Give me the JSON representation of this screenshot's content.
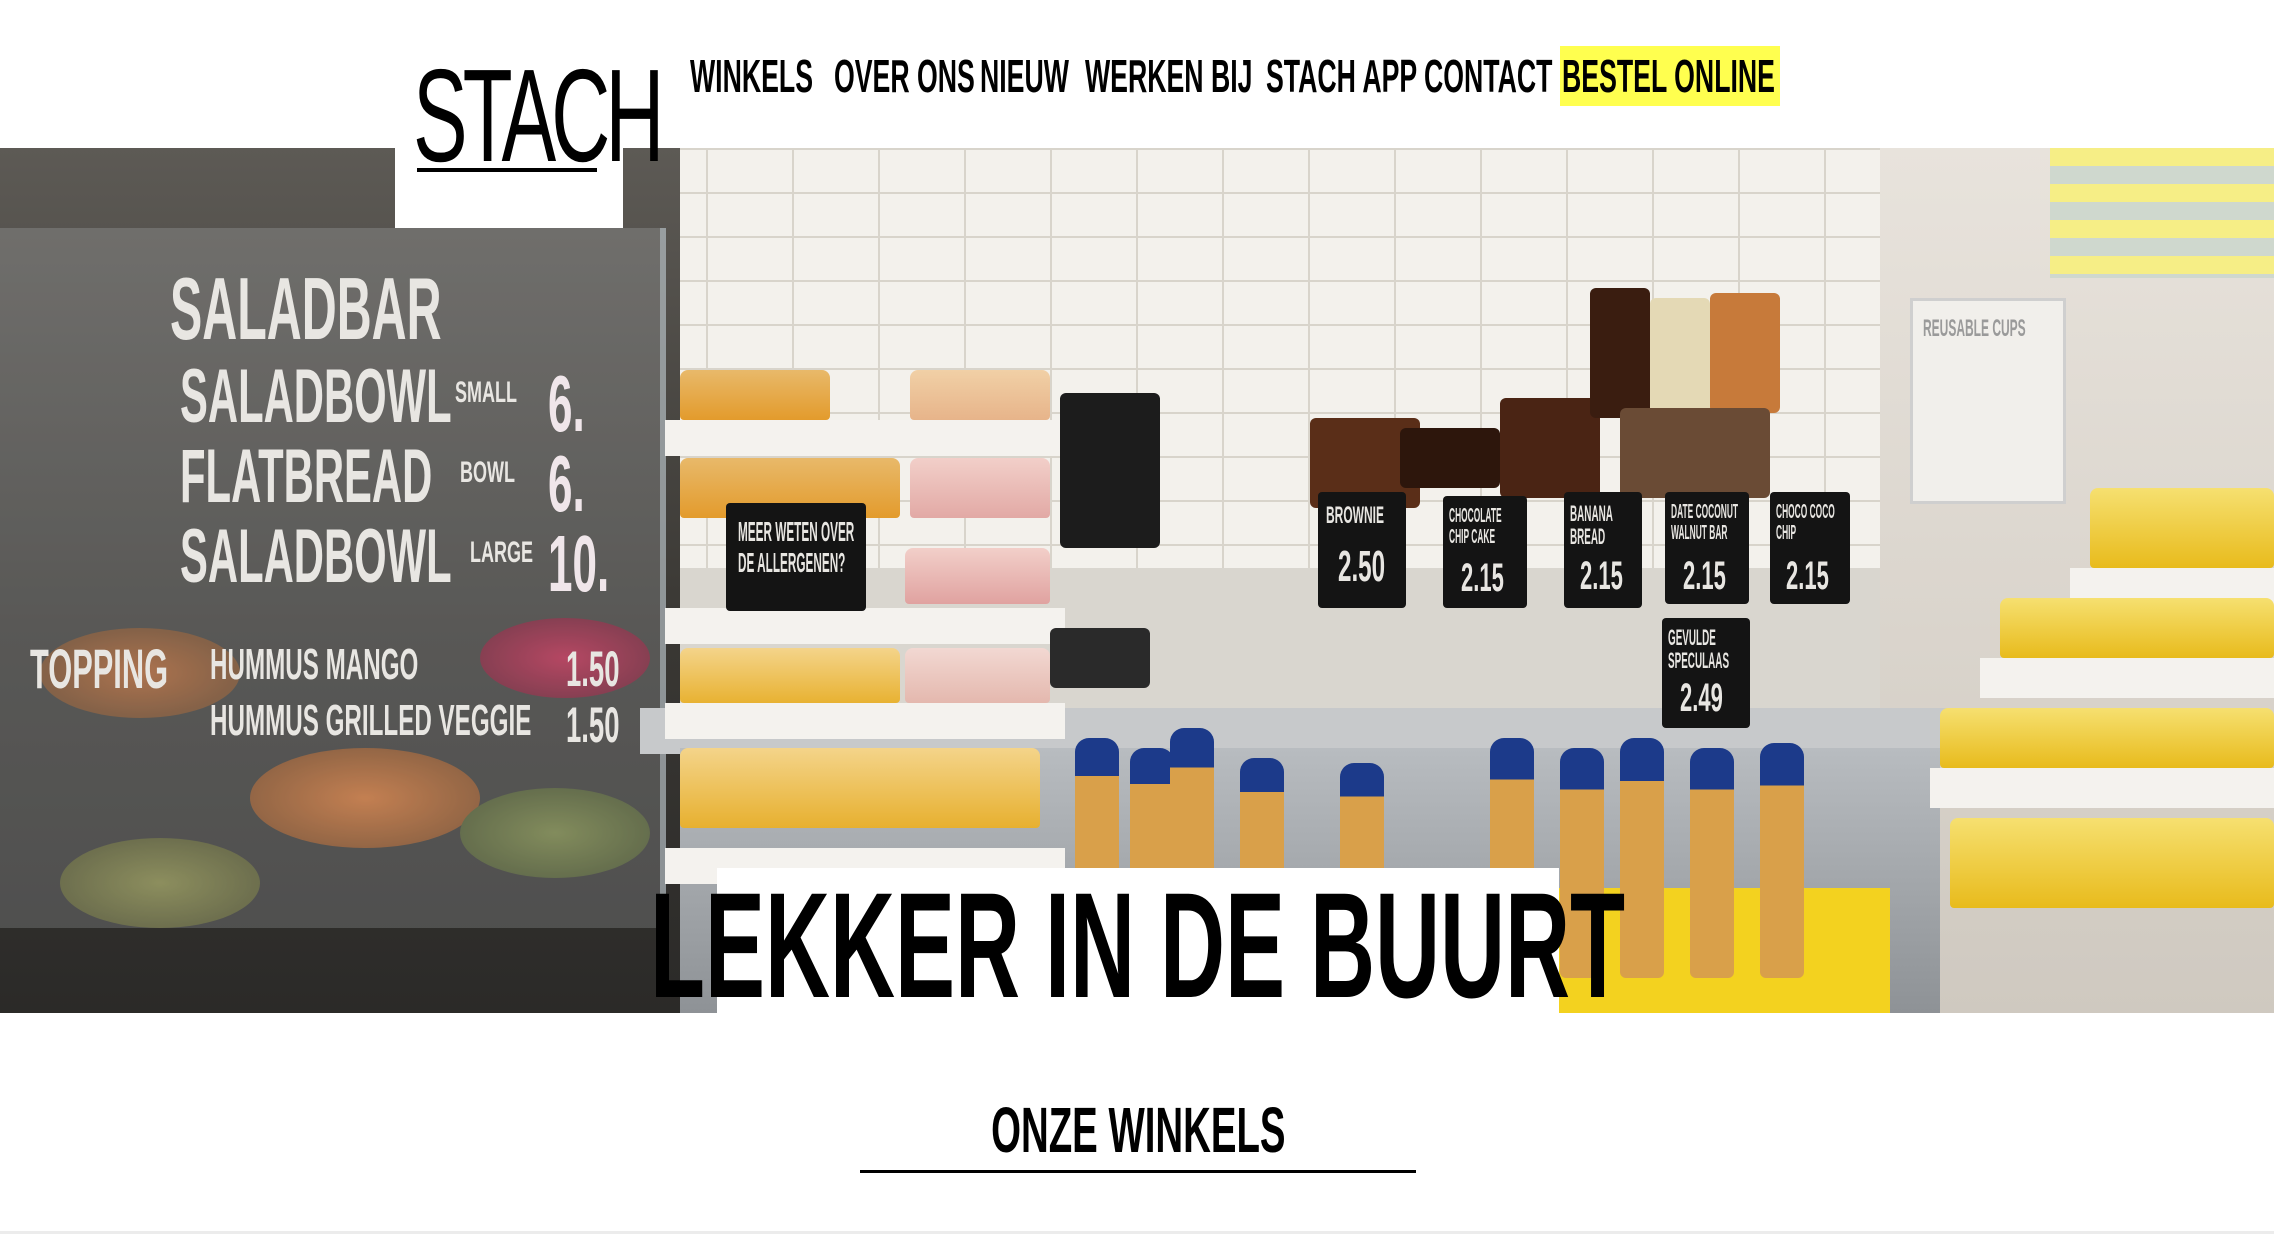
{
  "brand": {
    "logo_text": "STACH"
  },
  "nav": {
    "items": [
      {
        "label": "WINKELS"
      },
      {
        "label": "OVER ONS"
      },
      {
        "label": "NIEUW"
      },
      {
        "label": "WERKEN BIJ"
      },
      {
        "label": "STACH APP"
      },
      {
        "label": "CONTACT"
      },
      {
        "label": "BESTEL ONLINE"
      }
    ],
    "highlight_color": "#ffff4f"
  },
  "hero": {
    "caption": "LEKKER IN DE BUURT",
    "menu_board": {
      "title": "SALADBAR",
      "lines": [
        "SALADBOWL",
        "FLATBREAD",
        "SALADBOWL"
      ],
      "sizes": [
        "SMALL",
        "BOWL",
        "LARGE"
      ],
      "prices": [
        "6.",
        "6.",
        "10."
      ],
      "topping_label": "TOPPING",
      "toppings": [
        "HUMMUS MANGO",
        "HUMMUS GRILLED VEGGIE"
      ],
      "topping_prices": [
        "1.50",
        "1.50"
      ]
    },
    "signs": [
      {
        "name": "BROWNIE",
        "price": "2.50"
      },
      {
        "name": "CHOCOLATE CHIP CAKE",
        "price": "2.15"
      },
      {
        "name": "BANANA BREAD",
        "price": "2.15"
      },
      {
        "name": "DATE COCONUT WALNUT BAR",
        "price": "2.15"
      },
      {
        "name": "CHOCO COCO CHIP",
        "price": "2.15"
      },
      {
        "name": "GEVULDE SPECULAAS",
        "price": "2.49"
      }
    ],
    "allergen_sign": "MEER WETEN OVER DE ALLERGENEN?",
    "reusable_sign": "REUSABLE CUPS"
  },
  "section": {
    "title": "ONZE WINKELS"
  }
}
